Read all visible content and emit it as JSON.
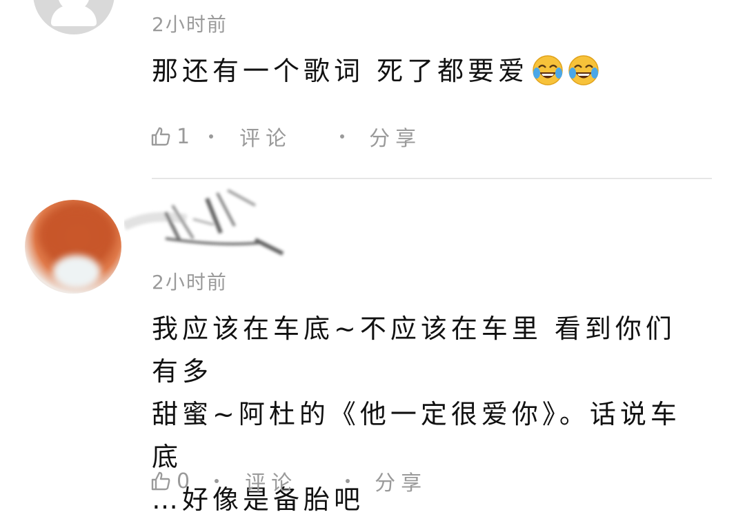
{
  "comments": [
    {
      "time": "2小时前",
      "content": "那还有一个歌词 死了都要爱",
      "emojis": [
        "tears-of-joy-icon",
        "tears-of-joy-icon"
      ],
      "likes": "1",
      "comment_label": "评论",
      "share_label": "分享"
    },
    {
      "time": "2小时前",
      "content_lines": [
        "我应该在车底~不应该在车里 看到你们有多",
        "甜蜜~阿杜的《他一定很爱你》。话说车底",
        "…好像是备胎吧"
      ],
      "likes": "0",
      "comment_label": "评论",
      "share_label": "分享"
    }
  ],
  "colors": {
    "meta_gray": "#9a9a9a",
    "divider": "#e6e6e6",
    "text": "#111111"
  }
}
